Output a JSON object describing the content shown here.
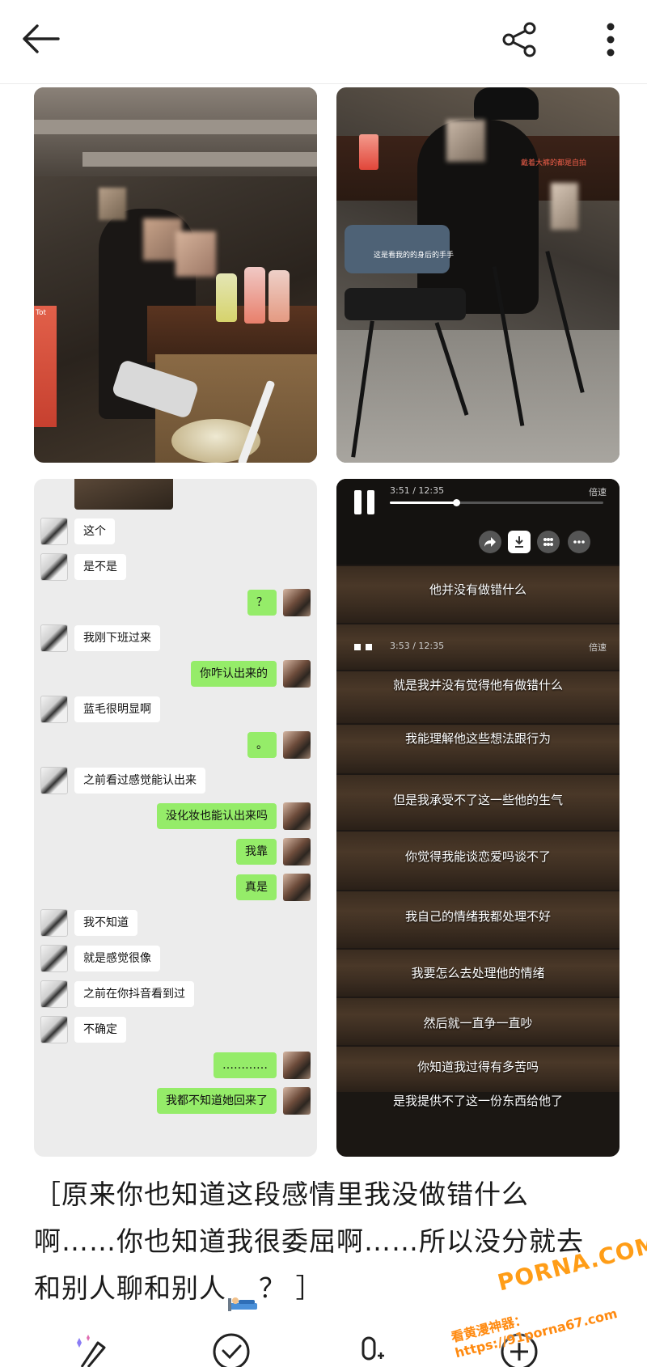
{
  "icons": {
    "back": "arrow-left-icon",
    "share": "share-icon",
    "more": "more-vertical-icon",
    "magic_pen": "magic-pen-icon",
    "check_circle": "check-circle-icon",
    "mic_translate": "mic-icon",
    "add": "add-circle-icon"
  },
  "photos": [
    {
      "kind": "bar-photo",
      "text": {
        "brand": "Tot"
      }
    },
    {
      "kind": "bar-photo",
      "text": {
        "top_caption": "戴着大裤的都是自拍",
        "side_caption": "这是看我的的身后的手手"
      }
    },
    {
      "kind": "chat-screenshot",
      "messages": [
        {
          "side": "left",
          "text": "这个"
        },
        {
          "side": "left",
          "text": "是不是"
        },
        {
          "side": "right",
          "text": "？"
        },
        {
          "side": "left",
          "text": "我刚下班过来"
        },
        {
          "side": "right",
          "text": "你咋认出来的"
        },
        {
          "side": "left",
          "text": "蓝毛很明显啊"
        },
        {
          "side": "right",
          "text": "。"
        },
        {
          "side": "left",
          "text": "之前看过感觉能认出来"
        },
        {
          "side": "right",
          "text": "没化妆也能认出来吗"
        },
        {
          "side": "right",
          "text": "我靠"
        },
        {
          "side": "right",
          "text": "真是"
        },
        {
          "side": "left",
          "text": "我不知道"
        },
        {
          "side": "left",
          "text": "就是感觉很像"
        },
        {
          "side": "left",
          "text": "之前在你抖音看到过"
        },
        {
          "side": "left",
          "text": "不确定"
        },
        {
          "side": "right",
          "text": "…………"
        },
        {
          "side": "right",
          "text": "我都不知道她回来了"
        }
      ]
    },
    {
      "kind": "video-subtitles",
      "player": {
        "time_1": "3:51 / 12:35",
        "progress_1": 0.31,
        "speed_1": "倍速",
        "time_2": "3:53 / 12:35",
        "speed_2": "倍速"
      },
      "subtitles": [
        "他并没有做错什么",
        "就是我并没有觉得他有做错什么",
        "我能理解他这些想法跟行为",
        "但是我承受不了这一些他的生气",
        "你觉得我能谈恋爱吗谈不了",
        "我自己的情绪我都处理不好",
        "我要怎么去处理他的情绪",
        "然后就一直争一直吵",
        "你知道我过得有多苦吗",
        "是我提供不了这一份东西给他了"
      ]
    }
  ],
  "caption": {
    "line1": "［原来你也知道这段感情里我没做错什么",
    "line2": "啊……你也知道我很委屈啊……所以没分就去",
    "line3_before": "和别人聊和别人",
    "line3_after": "？ ］"
  },
  "watermark": {
    "main": "PORNA.COM",
    "url": "看黄漫神器：https://91porna67.com"
  },
  "colors": {
    "accent_green": "#95ec69",
    "watermark_orange": "#ff9d17"
  }
}
